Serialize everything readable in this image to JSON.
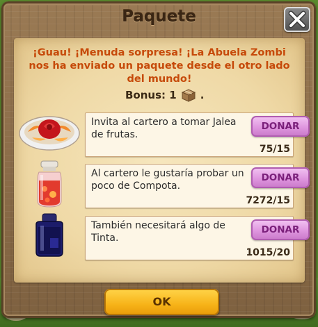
{
  "dialog": {
    "title": "Paquete",
    "message": "¡Guau! ¡Menuda sorpresa! ¡La Abuela Zombi nos ha enviado un paquete desde el otro lado del mundo!",
    "bonus_label": "Bonus: 1",
    "bonus_suffix": ".",
    "bonus_icon": "package-box-icon",
    "ok_label": "OK"
  },
  "items": [
    {
      "icon": "fruit-jelly-plate-icon",
      "text": "Invita al cartero a tomar Jalea de frutas.",
      "count": "75/15",
      "button": "DONAR"
    },
    {
      "icon": "compote-jar-icon",
      "text": "Al cartero le gustaría probar un poco de Compota.",
      "count": "7272/15",
      "button": "DONAR"
    },
    {
      "icon": "ink-bottle-icon",
      "text": "También necesitará algo de Tinta.",
      "count": "1015/20",
      "button": "DONAR"
    }
  ],
  "colors": {
    "message": "#c64a0a",
    "donar_button": "#df96df",
    "ok_button": "#f7b318",
    "wood": "#8b6b47",
    "parchment": "#f1dcaa"
  }
}
